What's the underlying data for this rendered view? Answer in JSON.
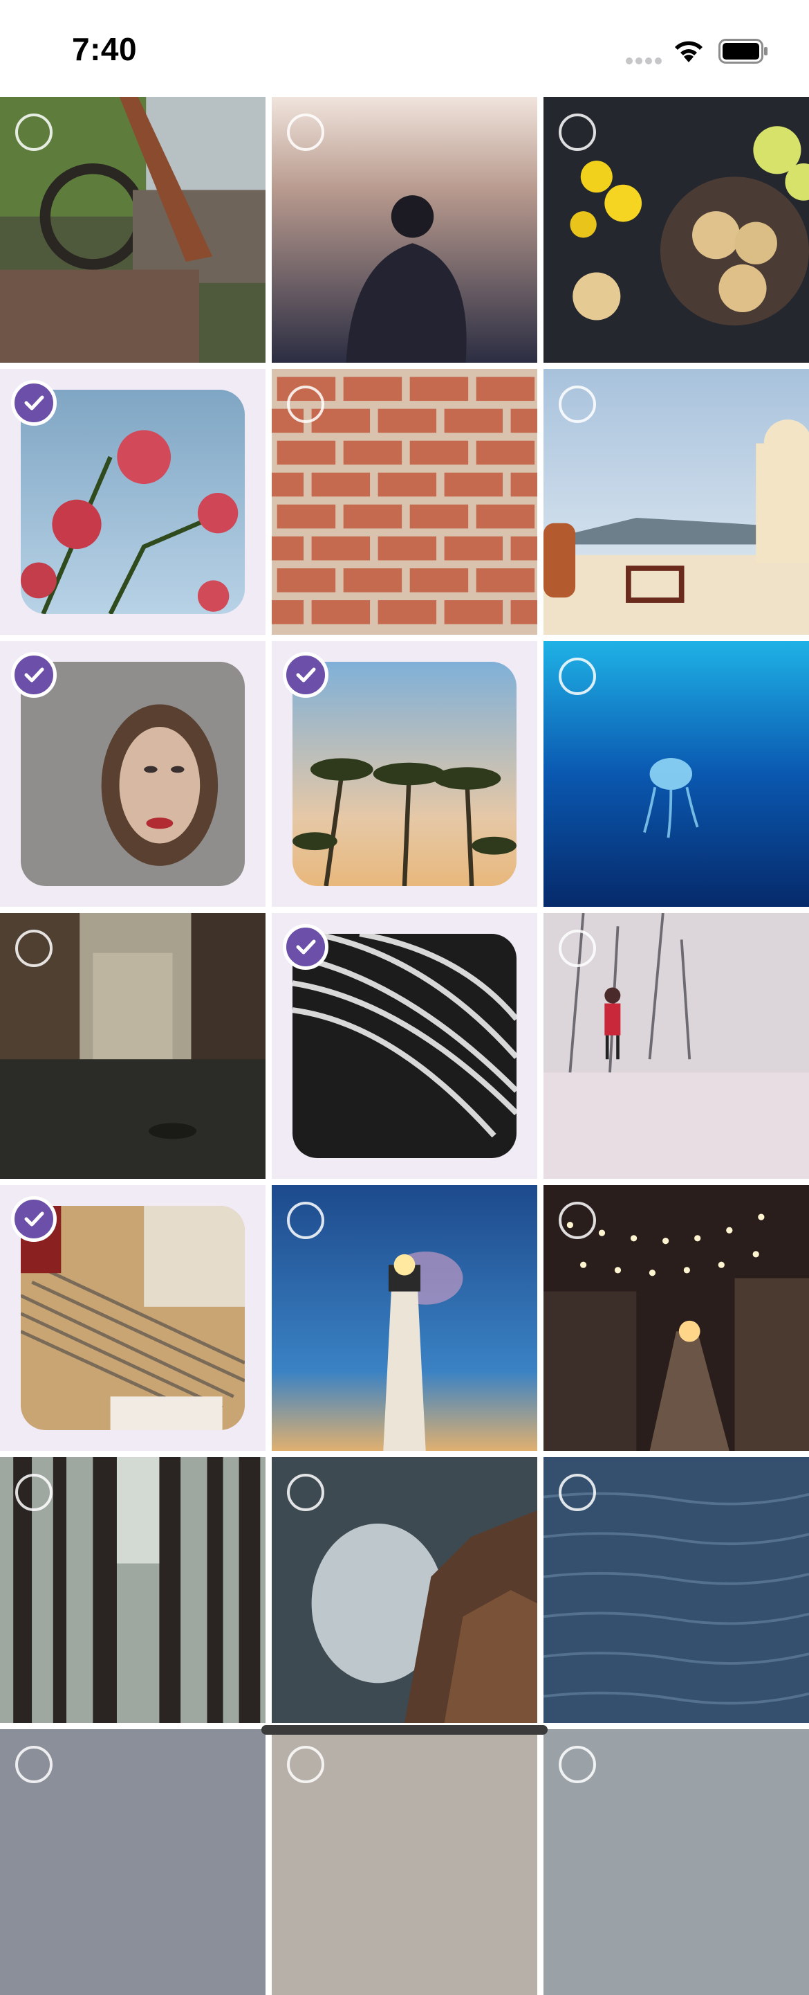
{
  "status_bar": {
    "time": "7:40",
    "icons": [
      "cellular-signal-icon",
      "wifi-icon",
      "battery-icon"
    ]
  },
  "photo_grid": {
    "columns": 3,
    "accent_color": "#6b4fa8",
    "selected_background": "#f1ebf6",
    "photos": [
      {
        "subject": "car-interior",
        "selected": false
      },
      {
        "subject": "city-silhouette",
        "selected": false
      },
      {
        "subject": "flowers-cookies",
        "selected": false
      },
      {
        "subject": "pink-blossoms",
        "selected": true
      },
      {
        "subject": "brick-wall",
        "selected": false
      },
      {
        "subject": "santorini",
        "selected": false
      },
      {
        "subject": "woman-portrait",
        "selected": true
      },
      {
        "subject": "palm-trees",
        "selected": true
      },
      {
        "subject": "jellyfish",
        "selected": false
      },
      {
        "subject": "canal",
        "selected": false
      },
      {
        "subject": "architecture-spiral",
        "selected": true
      },
      {
        "subject": "snowy-field",
        "selected": false
      },
      {
        "subject": "drafting-tools",
        "selected": true
      },
      {
        "subject": "lighthouse",
        "selected": false
      },
      {
        "subject": "night-street",
        "selected": false
      },
      {
        "subject": "forest",
        "selected": false
      },
      {
        "subject": "ocean-rocks",
        "selected": false
      },
      {
        "subject": "sea-water",
        "selected": false
      }
    ]
  }
}
